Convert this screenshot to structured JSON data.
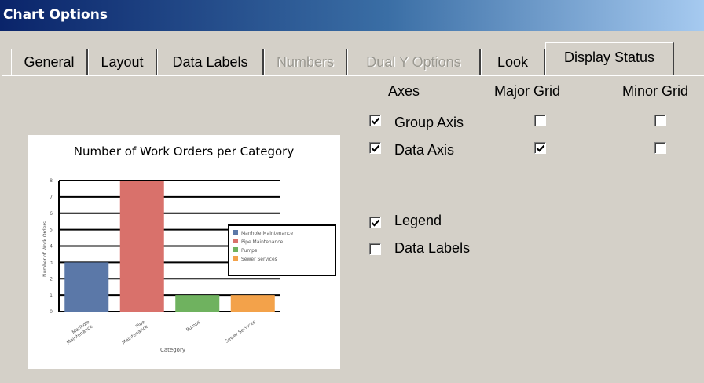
{
  "window": {
    "title": "Chart Options"
  },
  "tabs": [
    {
      "label": "General",
      "enabled": true,
      "selected": false
    },
    {
      "label": "Layout",
      "enabled": true,
      "selected": false
    },
    {
      "label": "Data Labels",
      "enabled": true,
      "selected": false
    },
    {
      "label": "Numbers",
      "enabled": false,
      "selected": false
    },
    {
      "label": "Dual Y Options",
      "enabled": false,
      "selected": false
    },
    {
      "label": "Look",
      "enabled": true,
      "selected": false
    },
    {
      "label": "Display Status",
      "enabled": true,
      "selected": true
    }
  ],
  "columns": {
    "axes": "Axes",
    "major_grid": "Major Grid",
    "minor_grid": "Minor Grid"
  },
  "rows": [
    {
      "label": "Group Axis",
      "axis_checked": true,
      "major_grid": false,
      "minor_grid": false
    },
    {
      "label": "Data Axis",
      "axis_checked": true,
      "major_grid": true,
      "minor_grid": false
    }
  ],
  "options": [
    {
      "label": "Legend",
      "checked": true
    },
    {
      "label": "Data Labels",
      "checked": false
    }
  ],
  "chart_data": {
    "type": "bar",
    "title": "Number of Work Orders per Category",
    "xlabel": "Category",
    "ylabel": "Number of Work Orders",
    "categories": [
      "Manhole Maintenance",
      "Pipe Maintenance",
      "Pumps",
      "Sewer Services"
    ],
    "tick_labels": [
      "Manhole\nMaintenance",
      "Pipe\nMaintenance",
      "Pumps",
      "Sewer Services"
    ],
    "values": [
      3,
      8,
      1,
      1
    ],
    "colors": [
      "#5b78a8",
      "#d9716b",
      "#6fb25f",
      "#f3a24a"
    ],
    "ylim": [
      0,
      8
    ],
    "yticks": [
      0,
      1,
      2,
      3,
      4,
      5,
      6,
      7,
      8
    ],
    "grid": true,
    "legend": [
      "Manhole Maintenance",
      "Pipe Maintenance",
      "Pumps",
      "Sewer Services"
    ],
    "legend_position": "right"
  }
}
